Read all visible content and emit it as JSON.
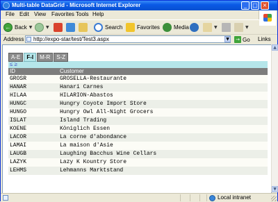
{
  "window": {
    "title": "Multi-table DataGrid - Microsoft Internet Explorer",
    "controls": {
      "minimize": "_",
      "maximize": "□",
      "close": "×"
    }
  },
  "menu": [
    "File",
    "Edit",
    "View",
    "Favorites",
    "Tools",
    "Help"
  ],
  "toolbar": {
    "back_label": "Back",
    "search_label": "Search",
    "favorites_label": "Favorites",
    "media_label": "Media"
  },
  "address": {
    "label": "Address",
    "url": "http://expo-star/test/Test3.aspx",
    "go_label": "Go",
    "links_label": "Links"
  },
  "grid": {
    "tabs": [
      {
        "label": "A-E",
        "active": false
      },
      {
        "label": "F-I",
        "active": true
      },
      {
        "label": "M-R",
        "active": false
      },
      {
        "label": "S-Z",
        "active": false
      }
    ],
    "pager": "≤ ≥",
    "columns": [
      "ID",
      "Customer"
    ],
    "rows": [
      [
        "GROSR",
        "GROSELLA-Restaurante"
      ],
      [
        "HANAR",
        "Hanari Carnes"
      ],
      [
        "HILAA",
        "HILARION-Abastos"
      ],
      [
        "HUNGC",
        "Hungry Coyote Import Store"
      ],
      [
        "HUNGO",
        "Hungry Owl All-Night Grocers"
      ],
      [
        "ISLAT",
        "Island Trading"
      ],
      [
        "KOENE",
        "Königlich Essen"
      ],
      [
        "LACOR",
        "La corne d'abondance"
      ],
      [
        "LAMAI",
        "La maison d'Asie"
      ],
      [
        "LAUGB",
        "Laughing Bacchus Wine Cellars"
      ],
      [
        "LAZYK",
        "Lazy K Kountry Store"
      ],
      [
        "LEHMS",
        "Lehmanns Marktstand"
      ]
    ]
  },
  "status": {
    "zone": "Local intranet"
  },
  "colors": {
    "titlebar": "#0a5ae6",
    "tab_active": "#b5e6ea",
    "tab_inactive": "#8c8c8c",
    "header": "#7d7d7d"
  }
}
